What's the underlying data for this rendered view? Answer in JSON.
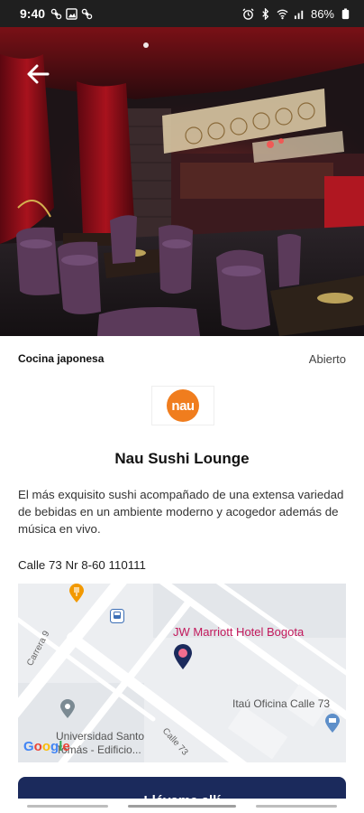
{
  "status_bar": {
    "time": "9:40",
    "battery": "86%",
    "left_icons": [
      "fan-icon",
      "gallery-icon",
      "fan-icon"
    ],
    "right_icons": [
      "alarm-icon",
      "bluetooth-icon",
      "wifi-icon",
      "signal-icon",
      "battery-icon"
    ]
  },
  "hero": {
    "back_icon": "arrow-left-icon"
  },
  "restaurant": {
    "category": "Cocina japonesa",
    "status": "Abierto",
    "logo_text": "nau",
    "name": "Nau Sushi Lounge",
    "description": "El más exquisito sushi acompañado de una extensa variedad de bebidas en un ambiente moderno y acogedor además de música en vivo.",
    "address": "Calle 73 Nr 8-60 110111"
  },
  "map": {
    "hotel_label": "JW Marriott Hotel Bogota",
    "bank_label": "Itaú Oficina Calle 73",
    "univ_label_line1": "Universidad Santo",
    "univ_label_line2": "Tomás - Edificio...",
    "street_carrera": "Carrera 9",
    "street_calle": "Calle 73",
    "google_letters": [
      "G",
      "o",
      "o",
      "g",
      "l",
      "e"
    ],
    "colors": {
      "pin": "#1b2a5c",
      "hotel_text": "#c2185b",
      "food_marker": "#f29900",
      "bank_marker": "#5e8fc9"
    }
  },
  "cta": {
    "label": "Llévame allí"
  },
  "colors": {
    "primary": "#1b2a5c",
    "logo_orange": "#f07d1e"
  }
}
